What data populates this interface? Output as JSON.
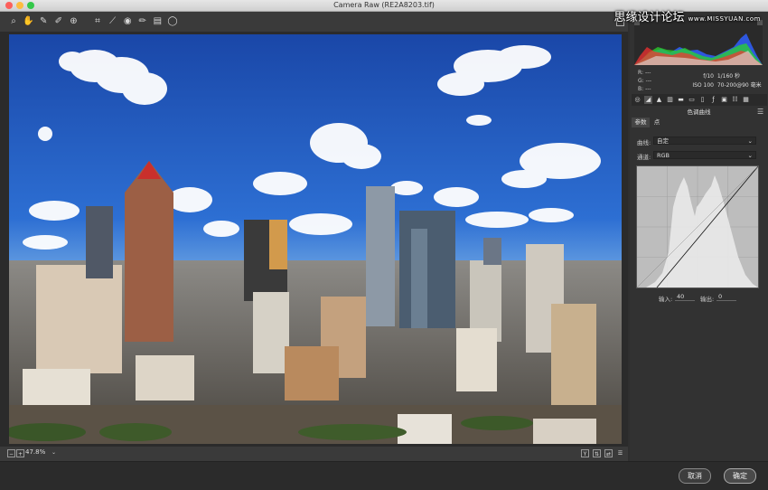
{
  "window": {
    "title": "Camera Raw (RE2A8203.tif)"
  },
  "watermark": {
    "main": "思缘设计论坛",
    "sub": "www.MISSYUAN.com"
  },
  "toolbar": {
    "tools": [
      {
        "name": "zoom-tool-icon",
        "glyph": "⌕"
      },
      {
        "name": "hand-tool-icon",
        "glyph": "✋"
      },
      {
        "name": "white-balance-tool-icon",
        "glyph": "✎"
      },
      {
        "name": "color-sampler-tool-icon",
        "glyph": "✐"
      },
      {
        "name": "targeted-adjustment-tool-icon",
        "glyph": "⊕"
      },
      {
        "name": "crop-tool-icon",
        "glyph": "⌗"
      },
      {
        "name": "straighten-tool-icon",
        "glyph": "⟋"
      },
      {
        "name": "red-eye-tool-icon",
        "glyph": "◉"
      },
      {
        "name": "adjustment-brush-icon",
        "glyph": "✏"
      },
      {
        "name": "graduated-filter-icon",
        "glyph": "▤"
      },
      {
        "name": "radial-filter-icon",
        "glyph": "◯"
      }
    ]
  },
  "readout": {
    "r_label": "R:",
    "r_value": "---",
    "g_label": "G:",
    "g_value": "---",
    "b_label": "B:",
    "b_value": "---",
    "aperture": "f/10",
    "shutter": "1/160 秒",
    "iso": "ISO 100",
    "lens": "70-200@90 毫米"
  },
  "panel": {
    "title": "色调曲线",
    "tabs": [
      {
        "label": "参数"
      },
      {
        "label": "点"
      }
    ],
    "curve_label": "曲线:",
    "curve_value": "自定",
    "channel_label": "通道:",
    "channel_value": "RGB",
    "input_label": "输入:",
    "input_value": "40",
    "output_label": "输出:",
    "output_value": "0"
  },
  "status": {
    "zoom": "47.8%"
  },
  "buttons": {
    "cancel": "取消",
    "ok": "确定"
  },
  "colors": {
    "accent": "#3b7fd6",
    "sky_top": "#1f4fb0",
    "panel_bg": "#323232"
  }
}
